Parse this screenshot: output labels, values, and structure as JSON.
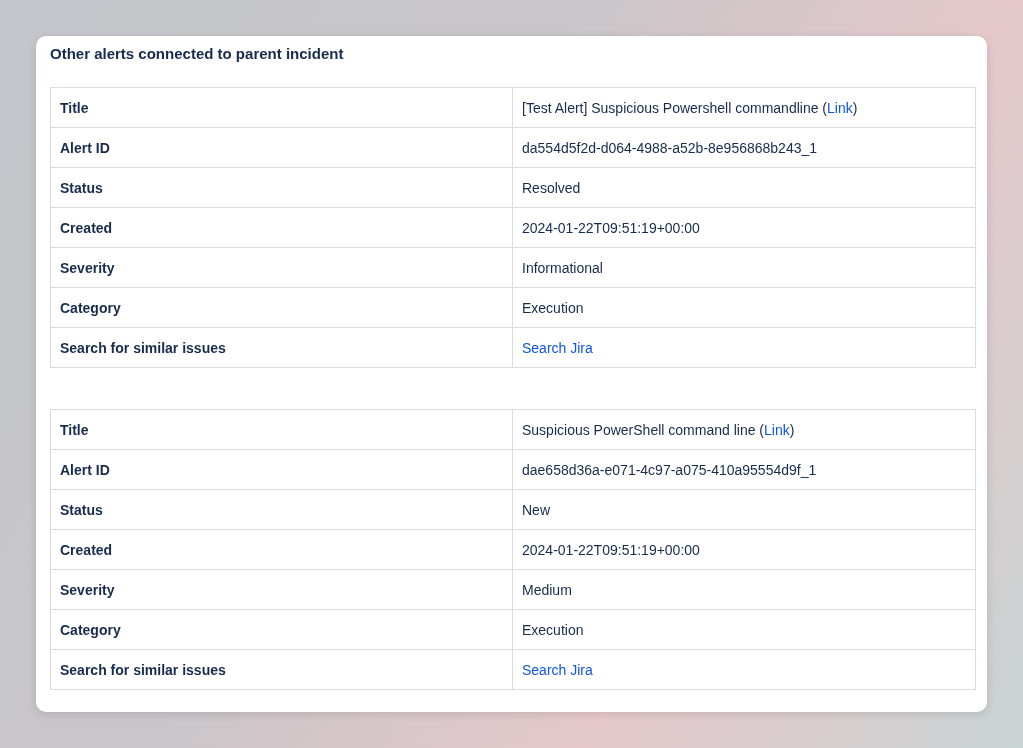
{
  "panel": {
    "title": "Other alerts connected to parent incident"
  },
  "alerts": [
    {
      "rows": [
        {
          "label": "Title",
          "kind": "segments",
          "segments": [
            {
              "kind": "text",
              "text": "[Test Alert] Suspicious Powershell commandline ("
            },
            {
              "kind": "link",
              "text": "Link"
            },
            {
              "kind": "text",
              "text": ")"
            }
          ]
        },
        {
          "label": "Alert ID",
          "kind": "text",
          "value": "da554d5f2d-d064-4988-a52b-8e956868b243_1"
        },
        {
          "label": "Status",
          "kind": "text",
          "value": "Resolved"
        },
        {
          "label": "Created",
          "kind": "text",
          "value": "2024-01-22T09:51:19+00:00"
        },
        {
          "label": "Severity",
          "kind": "text",
          "value": "Informational"
        },
        {
          "label": "Category",
          "kind": "text",
          "value": "Execution"
        },
        {
          "label": "Search for similar issues",
          "kind": "link",
          "value": "Search Jira"
        }
      ]
    },
    {
      "rows": [
        {
          "label": "Title",
          "kind": "segments",
          "segments": [
            {
              "kind": "text",
              "text": "Suspicious PowerShell command line ("
            },
            {
              "kind": "link",
              "text": "Link"
            },
            {
              "kind": "text",
              "text": ")"
            }
          ]
        },
        {
          "label": "Alert ID",
          "kind": "text",
          "value": "dae658d36a-e071-4c97-a075-410a95554d9f_1"
        },
        {
          "label": "Status",
          "kind": "text",
          "value": "New"
        },
        {
          "label": "Created",
          "kind": "text",
          "value": "2024-01-22T09:51:19+00:00"
        },
        {
          "label": "Severity",
          "kind": "text",
          "value": "Medium"
        },
        {
          "label": "Category",
          "kind": "text",
          "value": "Execution"
        },
        {
          "label": "Search for similar issues",
          "kind": "link",
          "value": "Search Jira"
        }
      ]
    }
  ]
}
